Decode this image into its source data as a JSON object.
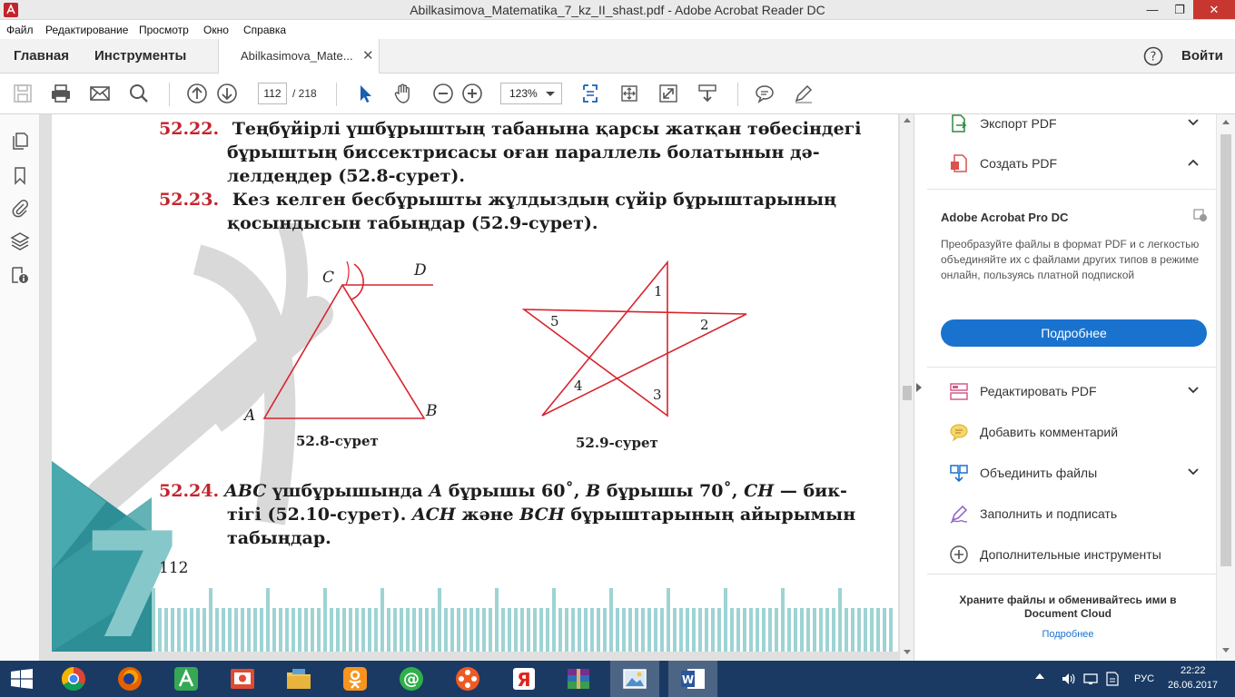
{
  "window": {
    "title": "Abilkasimova_Matematika_7_kz_II_shast.pdf - Adobe Acrobat Reader DC"
  },
  "menu": [
    "Файл",
    "Редактирование",
    "Просмотр",
    "Окно",
    "Справка"
  ],
  "tabs": {
    "home": "Главная",
    "tools": "Инструменты",
    "document": "Abilkasimova_Mate...",
    "login": "Войти"
  },
  "toolbar": {
    "current_page": "112",
    "total_pages": "/ 218",
    "zoom": "123%"
  },
  "document": {
    "p52_22": {
      "num": "52.22.",
      "lines": [
        "Теңбүйірлі үшбұрыштың табанына қарсы жатқан төбесіндегі",
        "бұрыштың биссектрисасы оған параллель болатынын дә-",
        "лелдеңдер (52.8-сурет)."
      ]
    },
    "p52_23": {
      "num": "52.23.",
      "lines": [
        "Кез келген бесбұрышты жұлдыздың сүйір бұрыштарының",
        "қосындысын табыңдар (52.9-сурет)."
      ]
    },
    "fig1": {
      "caption": "52.8-сурет",
      "labels": {
        "A": "A",
        "B": "B",
        "C": "C",
        "D": "D"
      }
    },
    "fig2": {
      "caption": "52.9-сурет",
      "labels": [
        "1",
        "2",
        "3",
        "4",
        "5"
      ]
    },
    "p52_24": {
      "num": "52.24.",
      "line1_a": "ABC",
      "line1_b": " үшбұрышында ",
      "line1_c": "A",
      "line1_d": " бұрышы 60˚, ",
      "line1_e": "B",
      "line1_f": " бұрышы 70˚, ",
      "line1_g": "CH",
      "line1_h": " — бик-",
      "line2_a": "тігі (52.10-сурет). ",
      "line2_b": "ACH",
      "line2_c": " және ",
      "line2_d": "BCH",
      "line2_e": " бұрыштарының айырымын",
      "line3": "табыңдар."
    },
    "page_number": "112",
    "cover_digit": "7"
  },
  "right_panel": {
    "export_pdf": "Экспорт PDF",
    "create_pdf": "Создать PDF",
    "promo_title": "Adobe Acrobat Pro DC",
    "promo_text": "Преобразуйте файлы в формат PDF и с легкостью объединяйте их с файлами других типов в режиме онлайн, пользуясь платной подпиской",
    "promo_button": "Подробнее",
    "edit_pdf": "Редактировать PDF",
    "add_comment": "Добавить комментарий",
    "combine_files": "Объединить файлы",
    "fill_sign": "Заполнить и подписать",
    "more_tools": "Дополнительные инструменты",
    "cloud_text": "Храните файлы и обменивайтесь ими в Document Cloud",
    "cloud_link": "Подробнее"
  },
  "taskbar": {
    "language": "РУС",
    "time": "22:22",
    "date": "26.06.2017"
  },
  "colors": {
    "accent_blue": "#1a72cf",
    "problem_number_red": "#c4232d",
    "figure_red": "#d9232e",
    "taskbar": "#1b3a63"
  }
}
